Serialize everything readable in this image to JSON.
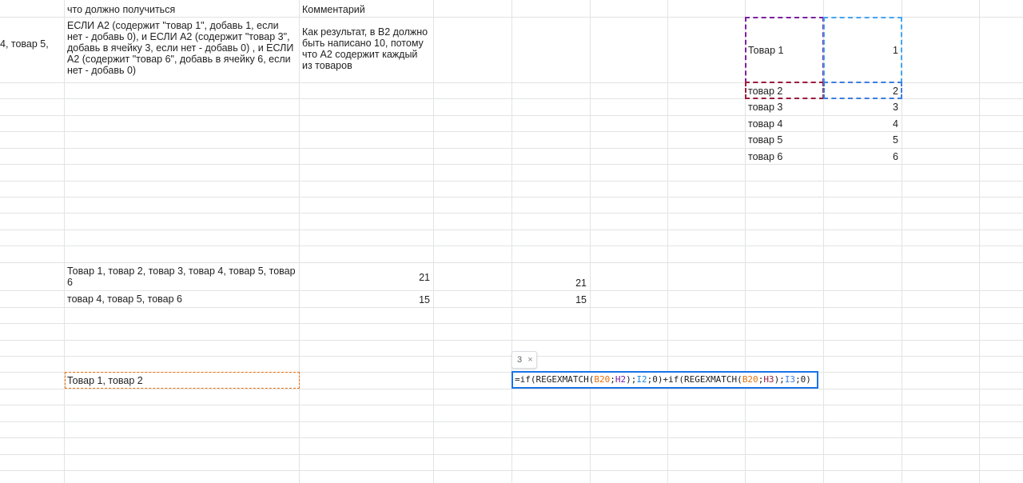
{
  "headers": {
    "b1": "что должно получиться",
    "c1": "Комментарий"
  },
  "cells": {
    "a2_partial": "4, товар 5,",
    "b2": "ЕСЛИ A2 (содержит \"товар 1\", добавь 1, если нет - добавь 0), и ЕСЛИ A2 (содержит \"товар 3\", добавь в ячейку 3, если нет - добавь 0) , и ЕСЛИ A2 (содержит \"товар 6\", добавь в ячейку 6, если нет - добавь 0)",
    "c2": "Как результат, в B2 должно быть написано 10, потому что A2 содержит каждый из товаров",
    "b_row_a": "Товар 1, товар 2, товар 3, товар 4, товар 5, товар 6",
    "c_row_a": "21",
    "e_row_a": "21",
    "b_row_b": "товар 4, товар 5, товар 6",
    "c_row_b": "15",
    "e_row_b": "15",
    "b20": "Товар 1, товар 2"
  },
  "lookup_table": [
    {
      "name": "Товар 1",
      "value": "1"
    },
    {
      "name": "товар 2",
      "value": "2"
    },
    {
      "name": "товар 3",
      "value": "3"
    },
    {
      "name": "товар 4",
      "value": "4"
    },
    {
      "name": "товар 5",
      "value": "5"
    },
    {
      "name": "товар 6",
      "value": "6"
    }
  ],
  "formula": {
    "t1": "=if(REGEXMATCH(",
    "r1": "B20",
    "t2": ";",
    "r2": "H2",
    "t3": ");",
    "r3": "I2",
    "t4": ";0)+if(REGEXMATCH(",
    "r4": "B20",
    "t5": ";",
    "r5": "H3",
    "t6": ");",
    "r6": "I3",
    "t7": ";0)"
  },
  "tooltip": {
    "value": "3",
    "close": "×"
  },
  "colors": {
    "ref_orange": "#e8710a",
    "ref_purple": "#7b1fa2",
    "ref_blue": "#1e88e5",
    "ref_maroon": "#9c1c3c",
    "ref_lightblue": "#42a5f5",
    "ref_steelblue": "#3d7ee0",
    "selection": "#1a73e8"
  }
}
